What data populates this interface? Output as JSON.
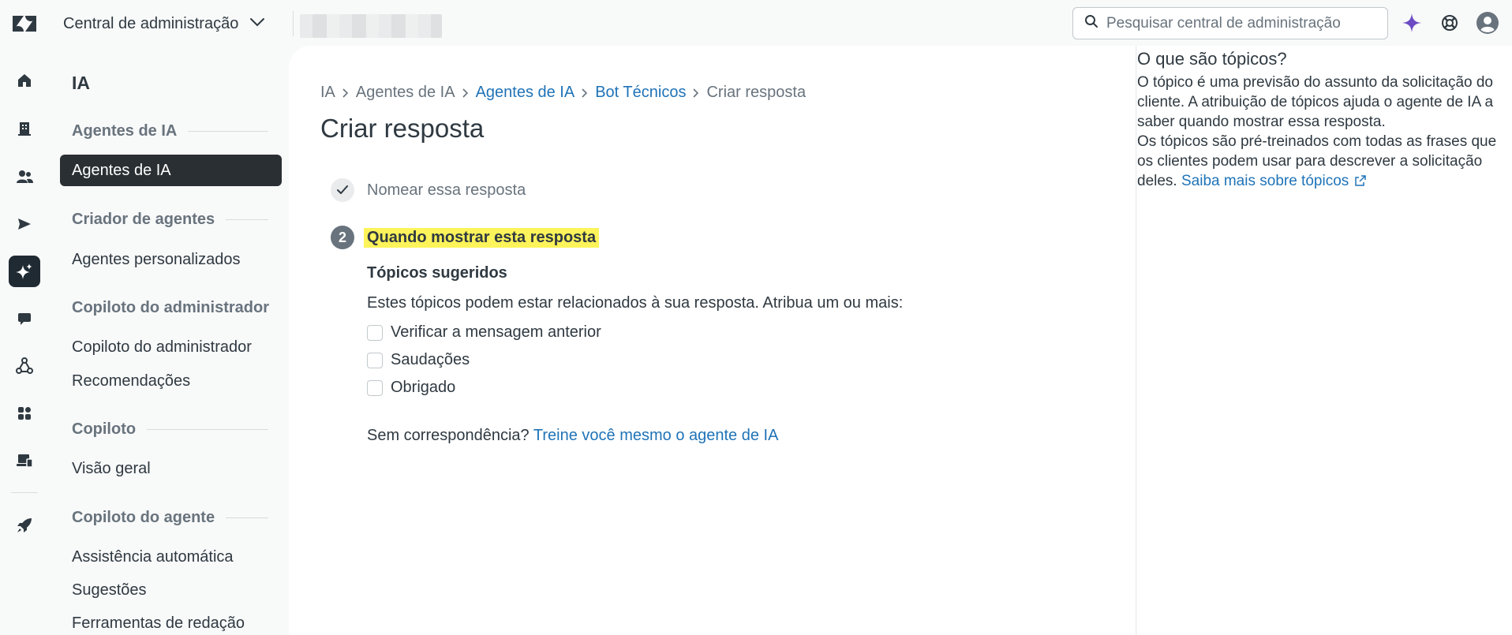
{
  "header": {
    "product_title": "Central de administração",
    "search_placeholder": "Pesquisar central de administração",
    "icons": [
      "zendesk-logo",
      "chevron-down-icon",
      "search-icon",
      "ai-sparkle-icon",
      "help-lifebuoy-icon",
      "user-avatar-icon"
    ]
  },
  "rail": {
    "items": [
      {
        "name": "home-icon"
      },
      {
        "name": "building-icon"
      },
      {
        "name": "people-icon"
      },
      {
        "name": "send-icon"
      },
      {
        "name": "ai-sparkle-icon",
        "active": true
      },
      {
        "name": "chat-icon"
      },
      {
        "name": "objects-icon"
      },
      {
        "name": "apps-icon"
      },
      {
        "name": "workspace-icon"
      },
      {
        "name": "rocket-icon"
      }
    ]
  },
  "subnav": {
    "section_title": "IA",
    "groups": [
      {
        "header": "Agentes de IA",
        "items": [
          "Agentes de IA"
        ]
      },
      {
        "header": "Criador de agentes",
        "items": [
          "Agentes personalizados"
        ]
      },
      {
        "header": "Copiloto do administrador",
        "items": [
          "Copiloto do administrador",
          "Recomendações"
        ]
      },
      {
        "header": "Copiloto",
        "items": [
          "Visão geral"
        ]
      },
      {
        "header": "Copiloto do agente",
        "items": [
          "Assistência automática",
          "Sugestões",
          "Ferramentas de redação"
        ]
      }
    ]
  },
  "breadcrumb": {
    "items": [
      "IA",
      "Agentes de IA",
      "Agentes de IA",
      "Bot Técnicos",
      "Criar resposta"
    ]
  },
  "main": {
    "title": "Criar resposta",
    "step1_label": "Nomear essa resposta",
    "step2_number": "2",
    "step2_label": "Quando mostrar esta resposta",
    "topics_heading": "Tópicos sugeridos",
    "topics_description": "Estes tópicos podem estar relacionados à sua resposta. Atribua um ou mais:",
    "topics": [
      "Verificar a mensagem anterior",
      "Saudações",
      "Obrigado"
    ],
    "no_match_text": "Sem correspondência?",
    "no_match_link": "Treine você mesmo o agente de IA"
  },
  "help": {
    "title": "O que são tópicos?",
    "para1": "O tópico é uma previsão do assunto da solicitação do cliente. A atribuição de tópicos ajuda o agente de IA a saber quando mostrar essa resposta.",
    "para2": "Os tópicos são pré-treinados com todas as frases que os clientes podem usar para descrever a solicitação deles.",
    "link": "Saiba mais sobre tópicos"
  },
  "colors": {
    "accent_link": "#1f73b7",
    "highlight": "#fdf35a",
    "selected_nav": "#2a2f33",
    "ai_purple": "#6a4bc4"
  }
}
